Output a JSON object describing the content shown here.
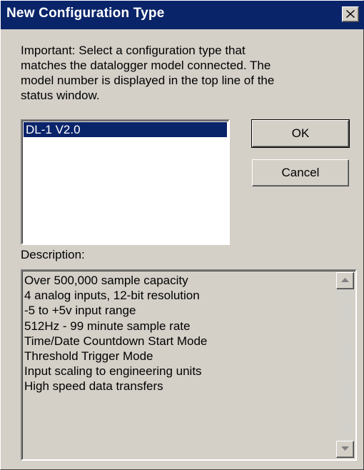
{
  "dialog": {
    "title": "New Configuration Type",
    "close_icon": "close-icon"
  },
  "instructions": {
    "lines": [
      "Important: Select a configuration type that",
      "matches the datalogger model connected.  The",
      "model number is displayed in the top line of the",
      "status window."
    ]
  },
  "config_list": {
    "items": [
      {
        "label": "DL-1 V2.0",
        "selected": true
      }
    ]
  },
  "buttons": {
    "ok_label": "OK",
    "cancel_label": "Cancel"
  },
  "description": {
    "label": "Description:",
    "lines": [
      "Over 500,000 sample capacity",
      "4 analog inputs, 12-bit resolution",
      "-5 to +5v input range",
      "512Hz - 99 minute sample rate",
      "Time/Date Countdown Start Mode",
      "Threshold Trigger Mode",
      "Input scaling to engineering units",
      "High speed data transfers"
    ],
    "scroll_up_icon": "scroll-up-arrow-icon",
    "scroll_down_icon": "scroll-down-arrow-icon"
  },
  "colors": {
    "titlebar": "#0a246a",
    "face": "#d4d0c8",
    "selection": "#0a246a"
  }
}
